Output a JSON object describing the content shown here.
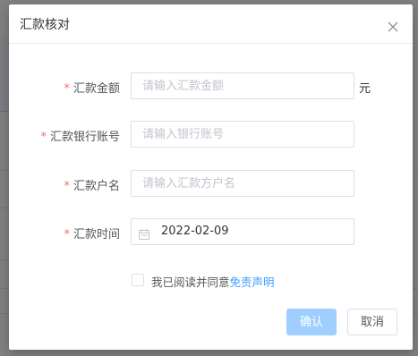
{
  "dialog": {
    "title": "汇款核对",
    "fields": [
      {
        "label": "汇款金额",
        "placeholder": "请输入汇款金额",
        "unit": "元"
      },
      {
        "label": "汇款银行账号",
        "placeholder": "请输入银行账号"
      },
      {
        "label": "汇款户名",
        "placeholder": "请输入汇款方户名"
      },
      {
        "label": "汇款时间",
        "value": "2022-02-09"
      }
    ],
    "required_mark": "*",
    "agreement": {
      "text": "我已阅读并同意",
      "link": "免责声明"
    },
    "buttons": {
      "confirm": "确认",
      "cancel": "取消"
    }
  },
  "colors": {
    "primary": "#409eff",
    "primary_disabled": "#a0cfff",
    "required": "#f56c6c"
  }
}
